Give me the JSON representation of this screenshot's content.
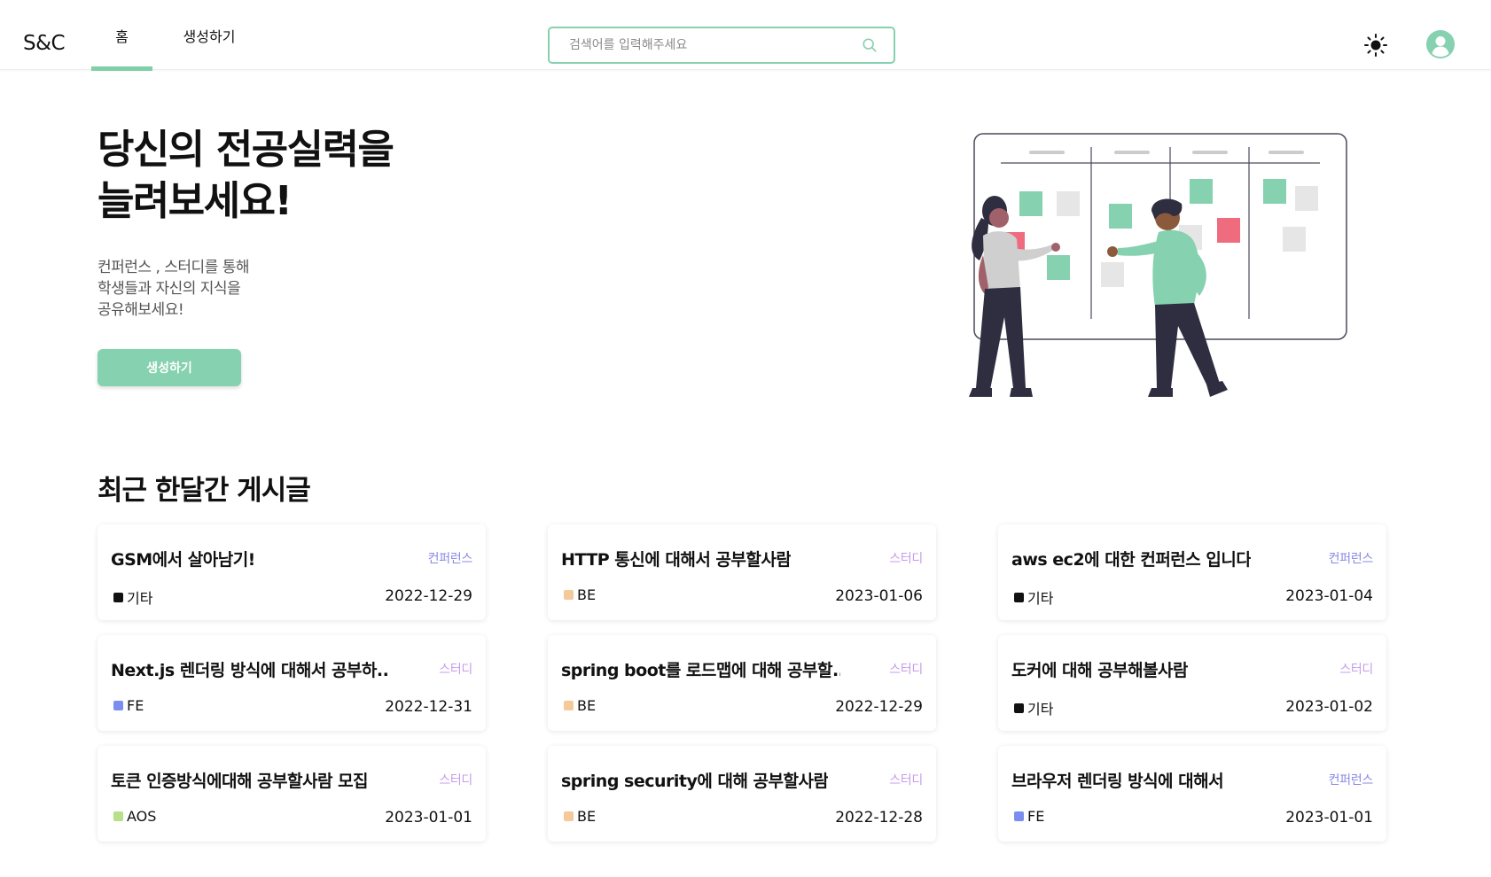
{
  "header": {
    "logo": "S&C",
    "tabs": [
      {
        "label": "홈",
        "active": true
      },
      {
        "label": "생성하기",
        "active": false
      }
    ],
    "search_placeholder": "검색어를 입력해주세요",
    "accent_color": "#86d1af",
    "icons": [
      "search-icon",
      "sun-icon",
      "user-avatar-icon"
    ]
  },
  "hero": {
    "title_line1": "당신의 전공실력을",
    "title_line2": "늘려보세요!",
    "desc_line1": "컨퍼런스 , 스터디를 통해",
    "desc_line2": "학생들과 자신의 지식을",
    "desc_line3": "공유해보세요!",
    "button_label": "생성하기"
  },
  "section": {
    "title": "최근 한달간 게시글"
  },
  "badge_colors": {
    "컨퍼런스": "#8a8ae6",
    "스터디": "#c79cec"
  },
  "category_colors": {
    "기타": "#111111",
    "BE": "#f5c99a",
    "FE": "#7b8ef0",
    "AOS": "#b8e08a"
  },
  "posts": [
    {
      "title": "GSM에서 살아남기!",
      "badge": "컨퍼런스",
      "category": "기타",
      "date": "2022-12-29"
    },
    {
      "title": "HTTP 통신에 대해서 공부할사람",
      "badge": "스터디",
      "category": "BE",
      "date": "2023-01-06"
    },
    {
      "title": "aws ec2에 대한 컨퍼런스 입니다",
      "badge": "컨퍼런스",
      "category": "기타",
      "date": "2023-01-04"
    },
    {
      "title": "Next.js 렌더링 방식에 대해서 공부하...",
      "badge": "스터디",
      "category": "FE",
      "date": "2022-12-31"
    },
    {
      "title": "spring boot를 로드맵에 대해 공부할...",
      "badge": "스터디",
      "category": "BE",
      "date": "2022-12-29"
    },
    {
      "title": "도커에 대해 공부해볼사람",
      "badge": "스터디",
      "category": "기타",
      "date": "2023-01-02"
    },
    {
      "title": "토큰 인증방식에대해 공부할사람 모집",
      "badge": "스터디",
      "category": "AOS",
      "date": "2023-01-01"
    },
    {
      "title": "spring security에 대해 공부할사람",
      "badge": "스터디",
      "category": "BE",
      "date": "2022-12-28"
    },
    {
      "title": "브라우저 렌더링 방식에 대해서",
      "badge": "컨퍼런스",
      "category": "FE",
      "date": "2023-01-01"
    }
  ]
}
